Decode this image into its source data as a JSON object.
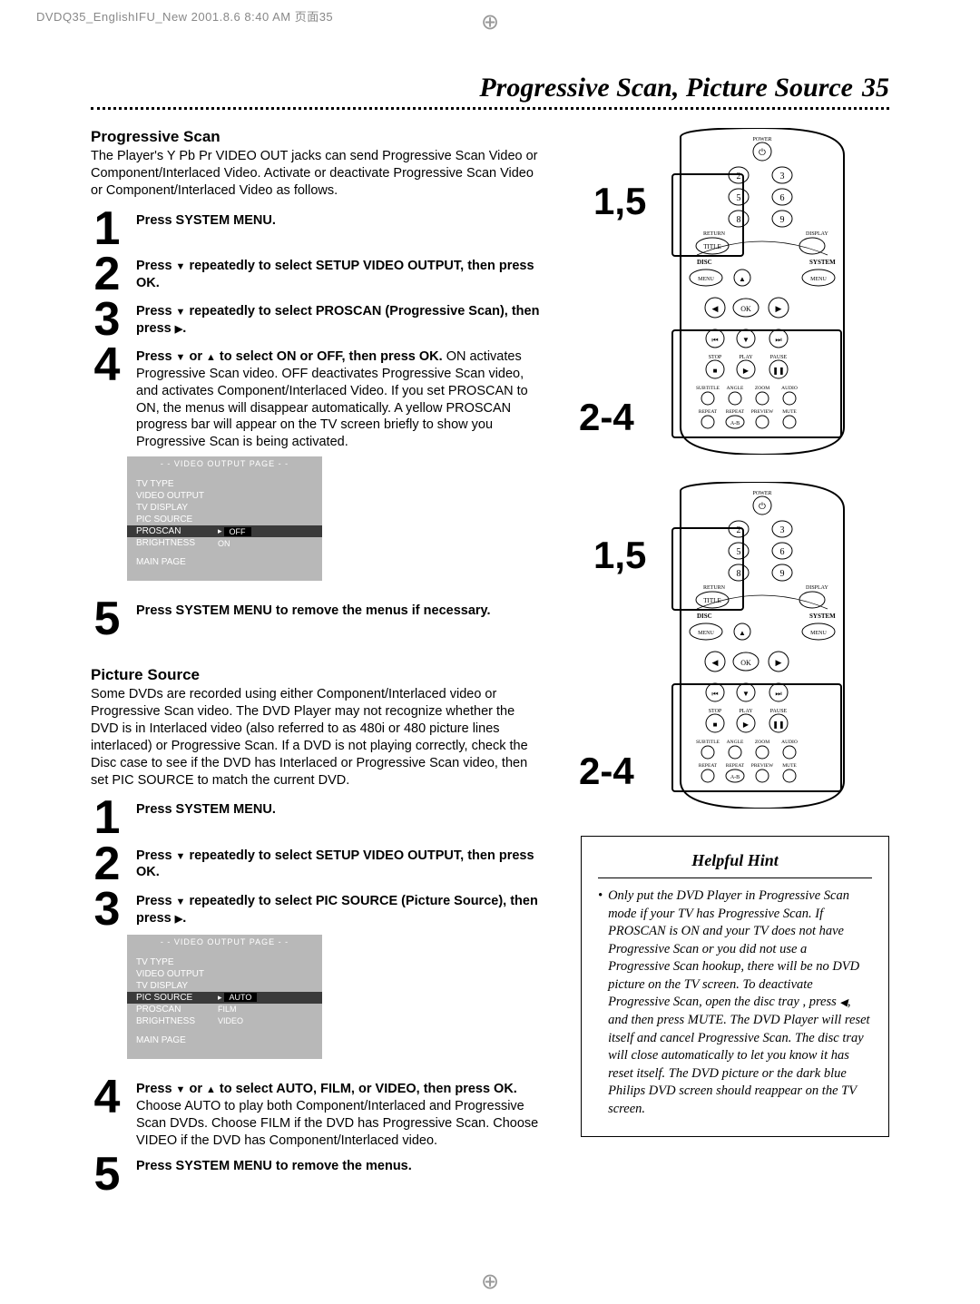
{
  "print_header": "DVDQ35_EnglishIFU_New  2001.8.6 8:40 AM  页面35",
  "page_title": "Progressive Scan, Picture Source",
  "page_number": "35",
  "section1": {
    "heading": "Progressive Scan",
    "intro": "The Player's Y Pb Pr VIDEO OUT jacks can send Progressive Scan Video or Component/Interlaced Video. Activate or deactivate Progressive Scan Video or Component/Interlaced Video as follows.",
    "steps": {
      "s1": "Press SYSTEM MENU.",
      "s2_a": "Press ",
      "s2_b": " repeatedly to select SETUP VIDEO OUTPUT, then press OK.",
      "s3_a": "Press ",
      "s3_b": " repeatedly to select PROSCAN (Progressive Scan), then press ",
      "s3_c": ".",
      "s4_a": "Press ",
      "s4_or": " or ",
      "s4_b": " to select ON or OFF, then press OK.",
      "s4_rest": " ON activates Progressive Scan video. OFF deactivates Progressive Scan video, and activates Component/Interlaced Video. If you set PROSCAN to ON, the menus will disappear automatically. A yellow PROSCAN progress bar will appear on the TV screen briefly to show you Progressive Scan is being activated.",
      "s5": "Press SYSTEM MENU to remove the menus if necessary."
    }
  },
  "menu1": {
    "title": "- -   VIDEO OUTPUT PAGE   - -",
    "rows": {
      "r1": "TV TYPE",
      "r2": "VIDEO OUTPUT",
      "r3": "TV DISPLAY",
      "r4": "PIC SOURCE",
      "r5": "PROSCAN",
      "r5v": "OFF",
      "r6": "BRIGHTNESS",
      "r6v": "ON",
      "r7": "MAIN PAGE"
    }
  },
  "section2": {
    "heading": "Picture Source",
    "intro": "Some DVDs are recorded using either Component/Interlaced video or Progressive Scan video. The DVD Player may not recognize whether the DVD is in Interlaced video (also referred to as 480i or 480 picture lines interlaced) or Progressive Scan. If a DVD is not playing correctly, check the Disc case to see if the DVD has Interlaced or Progressive Scan video, then set PIC SOURCE to match the current DVD.",
    "steps": {
      "s1": "Press SYSTEM MENU.",
      "s2_a": "Press ",
      "s2_b": " repeatedly to select SETUP VIDEO OUTPUT, then press OK.",
      "s3_a": "Press ",
      "s3_b": " repeatedly to select PIC SOURCE (Picture Source), then press ",
      "s3_c": ".",
      "s4_a": "Press ",
      "s4_or": " or ",
      "s4_b": " to select AUTO, FILM, or VIDEO, then press OK.",
      "s4_rest": " Choose AUTO to play both Component/Interlaced and Progressive Scan DVDs. Choose FILM if the DVD has Progressive Scan. Choose VIDEO if the DVD has Component/Interlaced video.",
      "s5": "Press SYSTEM MENU to remove the menus."
    }
  },
  "menu2": {
    "title": "- -   VIDEO OUTPUT PAGE   - -",
    "rows": {
      "r1": "TV TYPE",
      "r2": "VIDEO OUTPUT",
      "r3": "TV DISPLAY",
      "r4": "PIC SOURCE",
      "r4v": "AUTO",
      "r5": "PROSCAN",
      "r5v": "FILM",
      "r6": "BRIGHTNESS",
      "r6v": "VIDEO",
      "r7": "MAIN PAGE"
    }
  },
  "hint": {
    "title": "Helpful Hint",
    "body_a": "Only put the DVD Player in Progressive Scan mode if your TV has Progressive Scan. If PROSCAN is ON and your TV does not have Progressive Scan or you did not use a Progressive Scan hookup, there will be no DVD picture on the TV screen. To deactivate Progressive Scan, open the disc tray , press ",
    "body_b": ", and then press MUTE.  The DVD Player will reset itself and cancel Progressive Scan. The disc tray will close automatically to let you know it has reset itself. The DVD picture or the dark blue Philips DVD screen should reappear on the TV screen."
  },
  "callouts": {
    "c15": "1,5",
    "c24": "2-4"
  },
  "remote": {
    "power": "POWER",
    "digits": [
      "2",
      "3",
      "5",
      "6",
      "8",
      "9"
    ],
    "return": "RETURN",
    "display": "DISPLAY",
    "title": "TITLE",
    "disc": "DISC",
    "system": "SYSTEM",
    "menu": "MENU",
    "ok": "OK",
    "stop": "STOP",
    "play": "PLAY",
    "pause": "PAUSE",
    "subtitle": "SUBTITLE",
    "angle": "ANGLE",
    "zoom": "ZOOM",
    "audio": "AUDIO",
    "repeat": "REPEAT",
    "repeat_ab": "A-B",
    "preview": "PREVIEW",
    "mute": "MUTE"
  }
}
